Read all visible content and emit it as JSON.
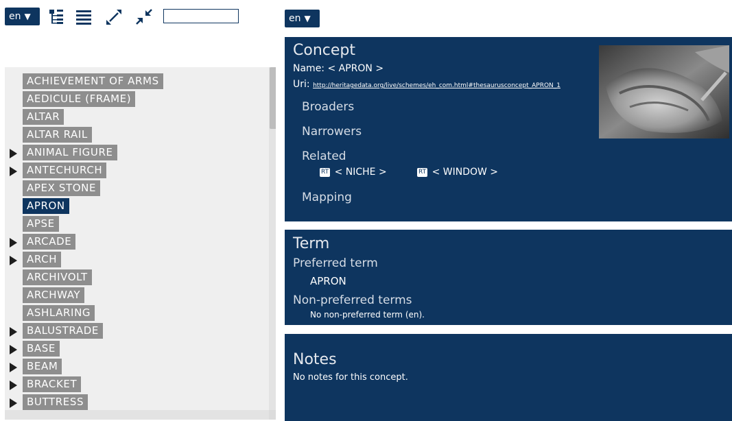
{
  "left": {
    "lang": "en",
    "tree_items": [
      {
        "label": "ACHIEVEMENT OF ARMS",
        "expandable": false,
        "selected": false
      },
      {
        "label": "AEDICULE (FRAME)",
        "expandable": false,
        "selected": false
      },
      {
        "label": "ALTAR",
        "expandable": false,
        "selected": false
      },
      {
        "label": "ALTAR RAIL",
        "expandable": false,
        "selected": false
      },
      {
        "label": "ANIMAL FIGURE",
        "expandable": true,
        "selected": false
      },
      {
        "label": "ANTECHURCH",
        "expandable": true,
        "selected": false
      },
      {
        "label": "APEX STONE",
        "expandable": false,
        "selected": false
      },
      {
        "label": "APRON",
        "expandable": false,
        "selected": true
      },
      {
        "label": "APSE",
        "expandable": false,
        "selected": false
      },
      {
        "label": "ARCADE",
        "expandable": true,
        "selected": false
      },
      {
        "label": "ARCH",
        "expandable": true,
        "selected": false
      },
      {
        "label": "ARCHIVOLT",
        "expandable": false,
        "selected": false
      },
      {
        "label": "ARCHWAY",
        "expandable": false,
        "selected": false
      },
      {
        "label": "ASHLARING",
        "expandable": false,
        "selected": false
      },
      {
        "label": "BALUSTRADE",
        "expandable": true,
        "selected": false
      },
      {
        "label": "BASE",
        "expandable": true,
        "selected": false
      },
      {
        "label": "BEAM",
        "expandable": true,
        "selected": false
      },
      {
        "label": "BRACKET",
        "expandable": true,
        "selected": false
      },
      {
        "label": "BUTTRESS",
        "expandable": true,
        "selected": false
      }
    ]
  },
  "right": {
    "lang": "en",
    "concept": {
      "title": "Concept",
      "name_label": "Name:",
      "name_value": "< APRON >",
      "uri_label": "Uri:",
      "uri_value": "http://heritagedata.org/live/schemes/eh_com.html#thesaurusconcept_APRON_1",
      "broaders_label": "Broaders",
      "narrowers_label": "Narrowers",
      "related_label": "Related",
      "related_badge": "RT",
      "related_items": [
        "< NICHE >",
        "< WINDOW >"
      ],
      "mapping_label": "Mapping"
    },
    "term": {
      "title": "Term",
      "preferred_label": "Preferred term",
      "preferred_value": "APRON",
      "nonpreferred_label": "Non-preferred terms",
      "nonpreferred_value": "No non-preferred term (en)."
    },
    "notes": {
      "title": "Notes",
      "value": "No notes for this concept."
    }
  },
  "colors": {
    "navy": "#0e355f",
    "tree_label": "#8e8e8e",
    "tree_bg": "#efefef"
  }
}
